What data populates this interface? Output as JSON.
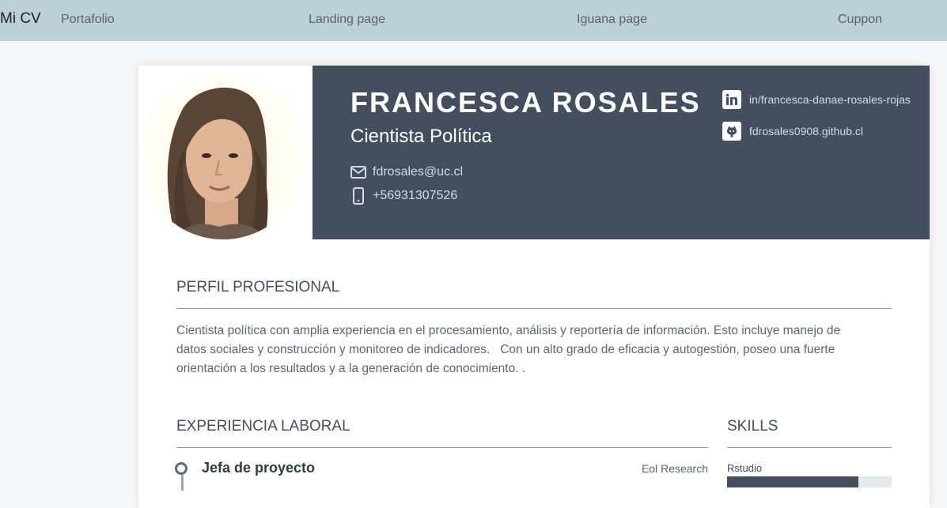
{
  "nav": {
    "brand": "Mi CV",
    "links": [
      "Portafolio",
      "Landing page",
      "Iguana page",
      "Cuppon"
    ]
  },
  "profile": {
    "name": "FRANCESCA ROSALES",
    "title": "Cientista Política",
    "email": "fdrosales@uc.cl",
    "phone": "+56931307526",
    "linkedin": "in/francesca-danae-rosales-rojas",
    "github": "fdrosales0908.github.cl"
  },
  "sections": {
    "perfil_title": "PERFIL PROFESIONAL",
    "perfil_text": "Cientista política con amplia experiencia en el procesamiento, análisis y reportería de información. Esto incluye manejo de datos sociales y construcción y monitoreo de indicadores.   Con un alto grado de eficacia y autogestión, poseo una fuerte orientación a los resultados y a la generación de conocimiento. .",
    "experiencia_title": "EXPERIENCIA LABORAL",
    "skills_title": "SKILLS"
  },
  "experience": [
    {
      "role": "Jefa de proyecto",
      "company": "Eol Research"
    }
  ],
  "skills": [
    {
      "name": "Rstudio",
      "level": 0.8
    }
  ],
  "icons": {
    "email": "envelope-icon",
    "phone": "mobile-phone-icon",
    "linkedin": "linkedin-icon",
    "github": "github-icon"
  },
  "colors": {
    "nav_bg": "#bcd1d6",
    "header_bg": "#434e5f",
    "page_bg": "#f6f7f8"
  }
}
